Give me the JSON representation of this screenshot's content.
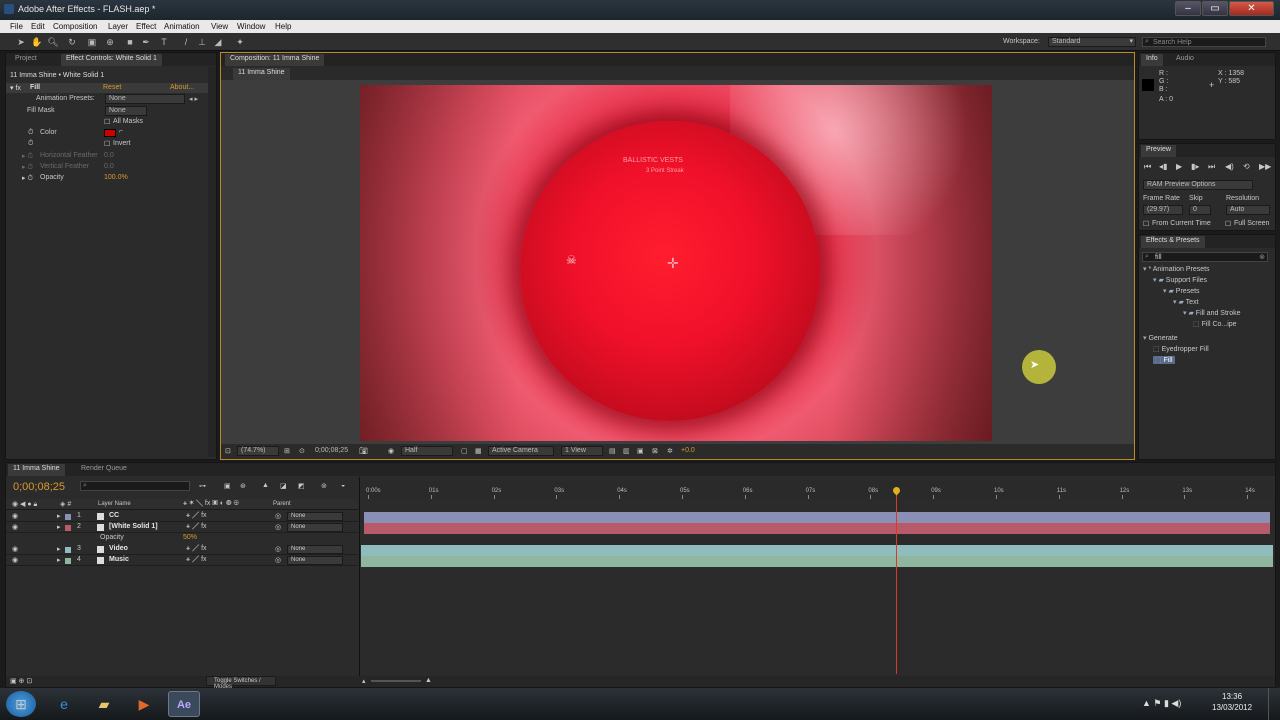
{
  "window": {
    "title": "Adobe After Effects - FLASH.aep *"
  },
  "menu": [
    "File",
    "Edit",
    "Composition",
    "Layer",
    "Effect",
    "Animation",
    "View",
    "Window",
    "Help"
  ],
  "toolbar": {
    "workspace_label": "Workspace:",
    "workspace_value": "Standard",
    "search_placeholder": "Search Help"
  },
  "left_panel": {
    "tabs": [
      "Project",
      "Effect Controls: White Solid 1"
    ],
    "breadcrumb": "11 Imma Shine • White Solid 1",
    "effect_name": "Fill",
    "reset": "Reset",
    "about": "About...",
    "anim_presets_label": "Animation Presets:",
    "anim_presets_value": "None",
    "fill_mask_label": "Fill Mask",
    "fill_mask_value": "None",
    "all_masks": "All Masks",
    "color_label": "Color",
    "invert_label": "Invert",
    "h_feather_label": "Horizontal Feather",
    "h_feather_value": "0.0",
    "v_feather_label": "Vertical Feather",
    "v_feather_value": "0.0",
    "opacity_label": "Opacity",
    "opacity_value": "100.0%",
    "fill_color": "#cc0000"
  },
  "comp_panel": {
    "tab": "Composition: 11 Imma Shine",
    "subtab": "11 Imma Shine",
    "zoom": "(74.7%)",
    "timecode": "0;00;08;25",
    "resolution": "Half",
    "camera": "Active Camera",
    "view": "1 View",
    "exposure": "+0.0",
    "hud_text_1": "BALLISTIC VESTS",
    "hud_text_2": "3 Point Streak"
  },
  "info_panel": {
    "tabs": [
      "Info",
      "Audio"
    ],
    "r": "R :",
    "g": "G :",
    "b": "B :",
    "a": "A : 0",
    "x": "X : 1358",
    "y": "Y : 585"
  },
  "preview_panel": {
    "tab": "Preview",
    "ram_options": "RAM Preview Options",
    "frame_rate_label": "Frame Rate",
    "skip_label": "Skip",
    "resolution_label": "Resolution",
    "frame_rate_value": "(29.97)",
    "skip_value": "0",
    "resolution_value": "Auto",
    "from_current": "From Current Time",
    "full_screen": "Full Screen"
  },
  "effects_panel": {
    "tab": "Effects & Presets",
    "search_value": "fill",
    "tree": [
      {
        "label": "* Animation Presets",
        "indent": 0
      },
      {
        "label": "Support Files",
        "indent": 1
      },
      {
        "label": "Presets",
        "indent": 2
      },
      {
        "label": "Text",
        "indent": 3
      },
      {
        "label": "Fill and Stroke",
        "indent": 4
      },
      {
        "label": "Fill Co...ipe",
        "indent": 5
      },
      {
        "label": "Generate",
        "indent": 0
      },
      {
        "label": "Eyedropper Fill",
        "indent": 1
      },
      {
        "label": "Fill",
        "indent": 1
      }
    ]
  },
  "timeline": {
    "tabs": [
      "11 Imma Shine",
      "Render Queue"
    ],
    "timecode": "0;00;08;25",
    "col_layer_name": "Layer Name",
    "col_parent": "Parent",
    "ruler": [
      "0:00s",
      "01s",
      "02s",
      "03s",
      "04s",
      "05s",
      "06s",
      "07s",
      "08s",
      "09s",
      "10s",
      "11s",
      "12s",
      "13s",
      "14s"
    ],
    "playhead_seconds": 8.4,
    "layers": [
      {
        "num": "1",
        "name": "CC",
        "parent": "None",
        "color": "#8a8fb5"
      },
      {
        "num": "2",
        "name": "[White Solid 1]",
        "parent": "None",
        "color": "#b85a6a"
      },
      {
        "num": "3",
        "name": "Video",
        "parent": "None",
        "color": "#8fbdbd"
      },
      {
        "num": "4",
        "name": "Music",
        "parent": "None",
        "color": "#8fb7a0"
      }
    ],
    "opacity_label": "Opacity",
    "opacity_value": "50%",
    "toggle_label": "Toggle Switches / Modes"
  },
  "taskbar": {
    "time": "13:36",
    "date": "13/03/2012",
    "ae_label": "Ae"
  }
}
